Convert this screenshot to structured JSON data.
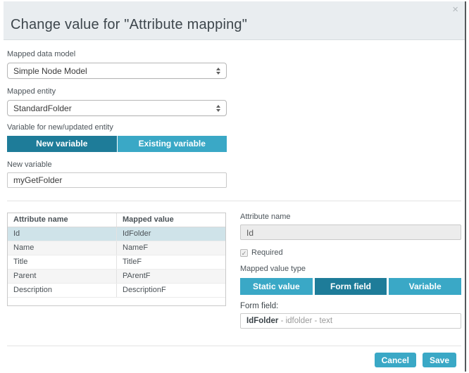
{
  "modal": {
    "title": "Change value for \"Attribute mapping\"",
    "close_glyph": "×"
  },
  "form": {
    "mapped_data_model": {
      "label": "Mapped data model",
      "value": "Simple Node Model"
    },
    "mapped_entity": {
      "label": "Mapped entity",
      "value": "StandardFolder"
    },
    "variable_toggle": {
      "label": "Variable for new/updated entity",
      "options": [
        "New variable",
        "Existing variable"
      ],
      "selected": "New variable"
    },
    "new_variable": {
      "label": "New variable",
      "value": "myGetFolder"
    }
  },
  "attributes_table": {
    "columns": [
      "Attribute name",
      "Mapped value"
    ],
    "rows": [
      {
        "attribute": "Id",
        "mapped": "IdFolder",
        "selected": true
      },
      {
        "attribute": "Name",
        "mapped": "NameF",
        "selected": false
      },
      {
        "attribute": "Title",
        "mapped": "TitleF",
        "selected": false
      },
      {
        "attribute": "Parent",
        "mapped": "PArentF",
        "selected": false
      },
      {
        "attribute": "Description",
        "mapped": "DescriptionF",
        "selected": false
      }
    ]
  },
  "detail_panel": {
    "attribute_name": {
      "label": "Attribute name",
      "value": "Id"
    },
    "required": {
      "label": "Required",
      "checked": true,
      "check_glyph": "✓"
    },
    "mapped_value_type": {
      "label": "Mapped value type",
      "options": [
        "Static value",
        "Form field",
        "Variable"
      ],
      "selected": "Form field"
    },
    "form_field": {
      "label": "Form field:",
      "value_primary": "IdFolder",
      "value_secondary": " - idfolder - text"
    }
  },
  "footer": {
    "cancel_label": "Cancel",
    "save_label": "Save"
  },
  "colors": {
    "accent_dark": "#1e7c99",
    "accent_light": "#3aa8c6",
    "header_bg": "#e9edf0",
    "row_highlight": "#cfe3e9"
  }
}
